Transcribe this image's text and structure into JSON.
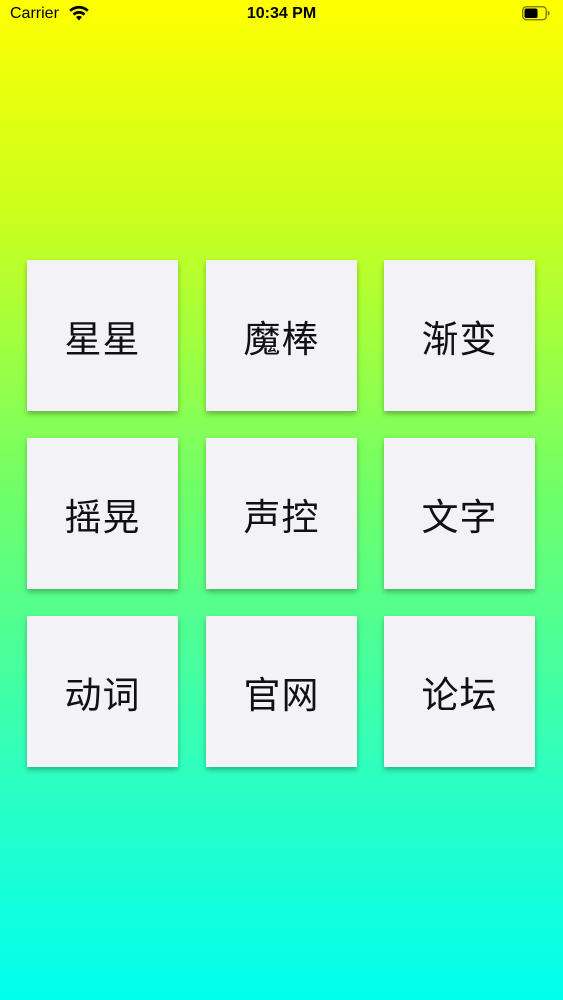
{
  "status_bar": {
    "carrier": "Carrier",
    "time": "10:34 PM",
    "icons": [
      "wifi-icon",
      "battery-icon"
    ]
  },
  "menu": {
    "items": [
      {
        "label": "星星"
      },
      {
        "label": "魔棒"
      },
      {
        "label": "渐变"
      },
      {
        "label": "摇晃"
      },
      {
        "label": "声控"
      },
      {
        "label": "文字"
      },
      {
        "label": "动词"
      },
      {
        "label": "官网"
      },
      {
        "label": "论坛"
      }
    ]
  },
  "colors": {
    "gradient_top": "#ffff00",
    "gradient_bottom": "#00ffee",
    "tile_background": "#f2f2f7",
    "tile_text": "#111111"
  }
}
